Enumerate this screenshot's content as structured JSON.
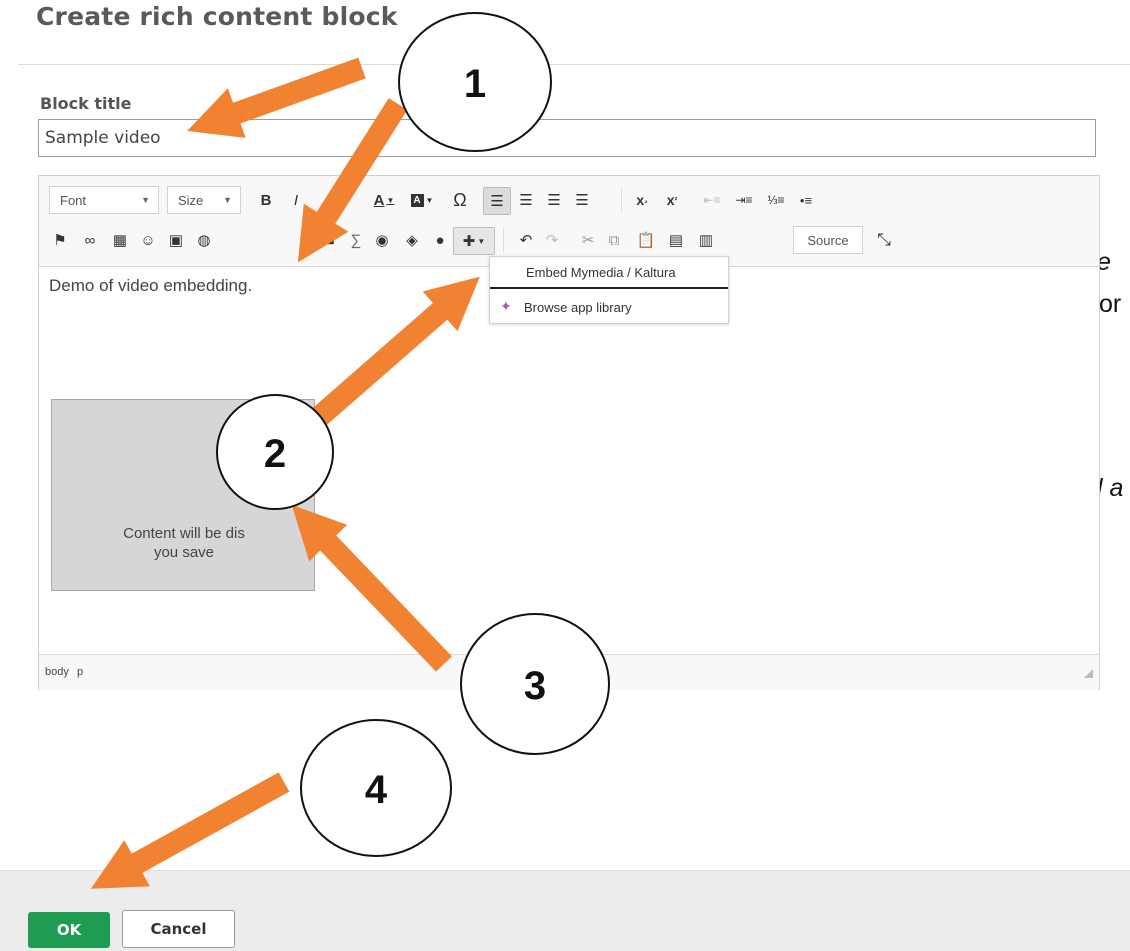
{
  "colors": {
    "arrow": "#f08232",
    "ok_button": "#1e9c52",
    "title": "#5a5a5a",
    "placeholder_bg": "#d6d6d6"
  },
  "dialog": {
    "title": "Create rich content block",
    "block_title_label": "Block title",
    "block_title_value": "Sample video"
  },
  "toolbar": {
    "font_combo": "Font",
    "size_combo": "Size",
    "source_label": "Source",
    "row1_icons": [
      "bold-icon",
      "italic-icon",
      "text-color-icon",
      "background-color-icon",
      "special-character-icon",
      "align-left-icon",
      "align-center-icon",
      "align-right-icon",
      "justify-icon",
      "subscript-icon",
      "superscript-icon",
      "decrease-indent-icon",
      "increase-indent-icon",
      "numbered-list-icon",
      "bulleted-list-icon"
    ],
    "row2_icons": [
      "flag-icon",
      "link-icon",
      "table-icon",
      "emoji-icon",
      "calendar-icon",
      "globe-icon",
      "video-icon",
      "sigma-icon",
      "media-icon",
      "app-icon",
      "comment-icon",
      "plugin-icon",
      "undo-icon",
      "redo-icon",
      "cut-icon",
      "copy-icon",
      "paste-icon",
      "paste-text-icon",
      "paste-word-icon",
      "fullscreen-icon"
    ]
  },
  "editor": {
    "body_text": "Demo of video embedding.",
    "placeholder_text_1": "Content will be dis",
    "placeholder_text_2": "you save",
    "status_path": [
      "body",
      "p"
    ]
  },
  "dropdown": {
    "items": [
      "Embed Mymedia / Kaltura",
      "Browse app library"
    ]
  },
  "footer": {
    "ok_label": "OK",
    "cancel_label": "Cancel"
  },
  "callouts": [
    "1",
    "2",
    "3",
    "4"
  ],
  "side_fragments": [
    "e",
    "for",
    "l a"
  ]
}
